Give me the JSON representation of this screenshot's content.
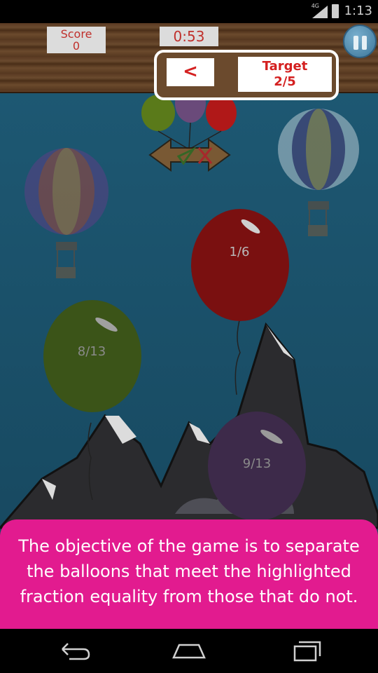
{
  "status_bar": {
    "time": "1:13",
    "network": "4G",
    "icons": [
      "signal-icon",
      "battery-icon"
    ]
  },
  "header": {
    "score_label": "Score",
    "score_value": "0",
    "timer": "0:53",
    "pause_icon": "pause-icon",
    "back_label": "<",
    "target_label": "Target",
    "target_value": "2/5"
  },
  "balloons": [
    {
      "label": "1/6",
      "color": "#7a1010"
    },
    {
      "label": "8/13",
      "color": "#3b5418"
    },
    {
      "label": "9/13",
      "color": "#3d2a4a"
    }
  ],
  "sort_arrow": {
    "icons": [
      "check-icon",
      "cross-icon"
    ]
  },
  "hint": {
    "text": "The objective of the game is to separate the balloons that meet the highlighted fraction equality from those that do not."
  },
  "nav": {
    "icons": [
      "back-nav-icon",
      "home-nav-icon",
      "recents-nav-icon"
    ]
  },
  "colors": {
    "hint_bg": "#e21b8f",
    "target_red": "#d42020",
    "sky": "#1e5a75"
  }
}
